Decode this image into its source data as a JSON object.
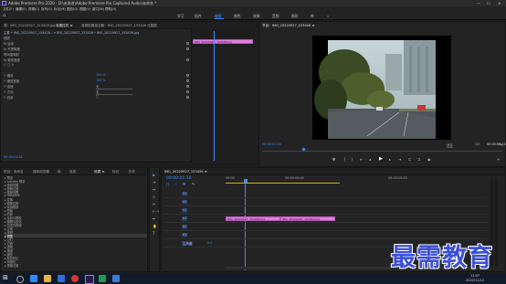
{
  "window": {
    "title": "Adobe Premiere Pro 2020 - D:\\未命名\\Adobe Premiere Pro Captured Audio\\未命名 *",
    "min": "—",
    "max": "☐",
    "close": "✕"
  },
  "menu": [
    "文件(F)",
    "编辑(E)",
    "剪辑(C)",
    "序列(S)",
    "标记(M)",
    "图形(G)",
    "视图(V)",
    "窗口(W)",
    "帮助(H)"
  ],
  "workspaces": {
    "home": "⌂",
    "items": [
      "学习",
      "组件",
      "编辑",
      "颜色",
      "效果",
      "音频",
      "图形",
      "库"
    ],
    "active": "编辑",
    "more": "»"
  },
  "source_panel": {
    "tabs": [
      "源：IMG_20220927_153426.jpg",
      "效果控件 ≡",
      "音频剪辑混合器：IMG_20220927_153426",
      "元数据"
    ],
    "active_tab": "效果控件 ≡",
    "header": "主要 * IMG_20220927_153426... ▾    IMG_20220927_153426 * IMG_20220927_153426.jpg",
    "clip_name": "IMG_20220927_153426.jpg",
    "section_video": "视频",
    "rows": [
      {
        "label": "fx  运动",
        "value": ""
      },
      {
        "label": "fx  不透明度",
        "value": ""
      },
      {
        "label": "   时间重映射",
        "value": ""
      },
      {
        "label": "fx  更改速度",
        "value": ""
      },
      {
        "label": "   ○  □  ✎",
        "value": ""
      },
      {
        "label": "  ⏱ 缩放",
        "value": "100 %"
      },
      {
        "label": "  ⏱ 缩放宽度",
        "value": "100 %"
      },
      {
        "label": "  ⏱ 倍速",
        "value": "无"
      },
      {
        "label": "  ⏱ 方向",
        "value": "无"
      },
      {
        "label": "  ⏱ 四舍",
        "value": "□"
      }
    ],
    "timecode": "00:00:01:18"
  },
  "program_panel": {
    "tab": "节目：IMG_20220927_153426 ≡",
    "timecode": "00:00:01:18",
    "fit": "适合",
    "zoom": "1/2",
    "duration": "00:00:06:24"
  },
  "project_panel": {
    "tabs": [
      "项目：未命名",
      "媒体浏览器",
      "库",
      "信息",
      "效果 ≡",
      "标记",
      "历史"
    ],
    "active_tab": "效果 ≡",
    "items": [
      "▸ 预设",
      "▸ Lumetri 预设",
      "▸ 音频效果",
      "▸ 音频过渡",
      "▾ 视频效果",
      "   ▸ Obsolete",
      "   ▸ 变换",
      "   ▸ 图像控制",
      "   ▸ 实用程序",
      "   ▸ 扭曲",
      "   ▸ 时间",
      "   ▸ 杂色与颗粒",
      "   ▸ 模糊与锐化",
      "   ▸ 沉浸式视频",
      "   ▸ 生成",
      "   ▸ 视频",
      "   ▸ 调整",
      "   ▸ 过时",
      "   ▸ 过渡",
      "   ▸ 透视",
      "   ▸ 通道",
      "   ▸ 键控",
      "   ▸ 颜色校正",
      "   ▸ 风格化",
      "▸ 视频过渡"
    ],
    "selected_index": 16
  },
  "tools": [
    "▶",
    "⇥",
    "↔",
    "◇",
    "✂",
    "⊢⊣",
    "✒",
    "✋",
    "T"
  ],
  "timeline": {
    "tab": "IMG_20220927_153426 ≡",
    "timecode": "00:00:01:18",
    "ruler": [
      "00:00",
      "00:00:05:00",
      "00:00:10:00"
    ],
    "tracks": [
      "V3",
      "V2",
      "V1",
      "A1",
      "A2",
      "A3",
      "主声道"
    ],
    "master_value": "0.0",
    "clips": [
      {
        "label": "IMG_20220927_153426.jpg"
      },
      {
        "label": "IMG_20220927_153410.jpg"
      }
    ]
  },
  "taskbar": {
    "time": "11:07",
    "date": "2022/11/12"
  },
  "watermark": "最需教育"
}
